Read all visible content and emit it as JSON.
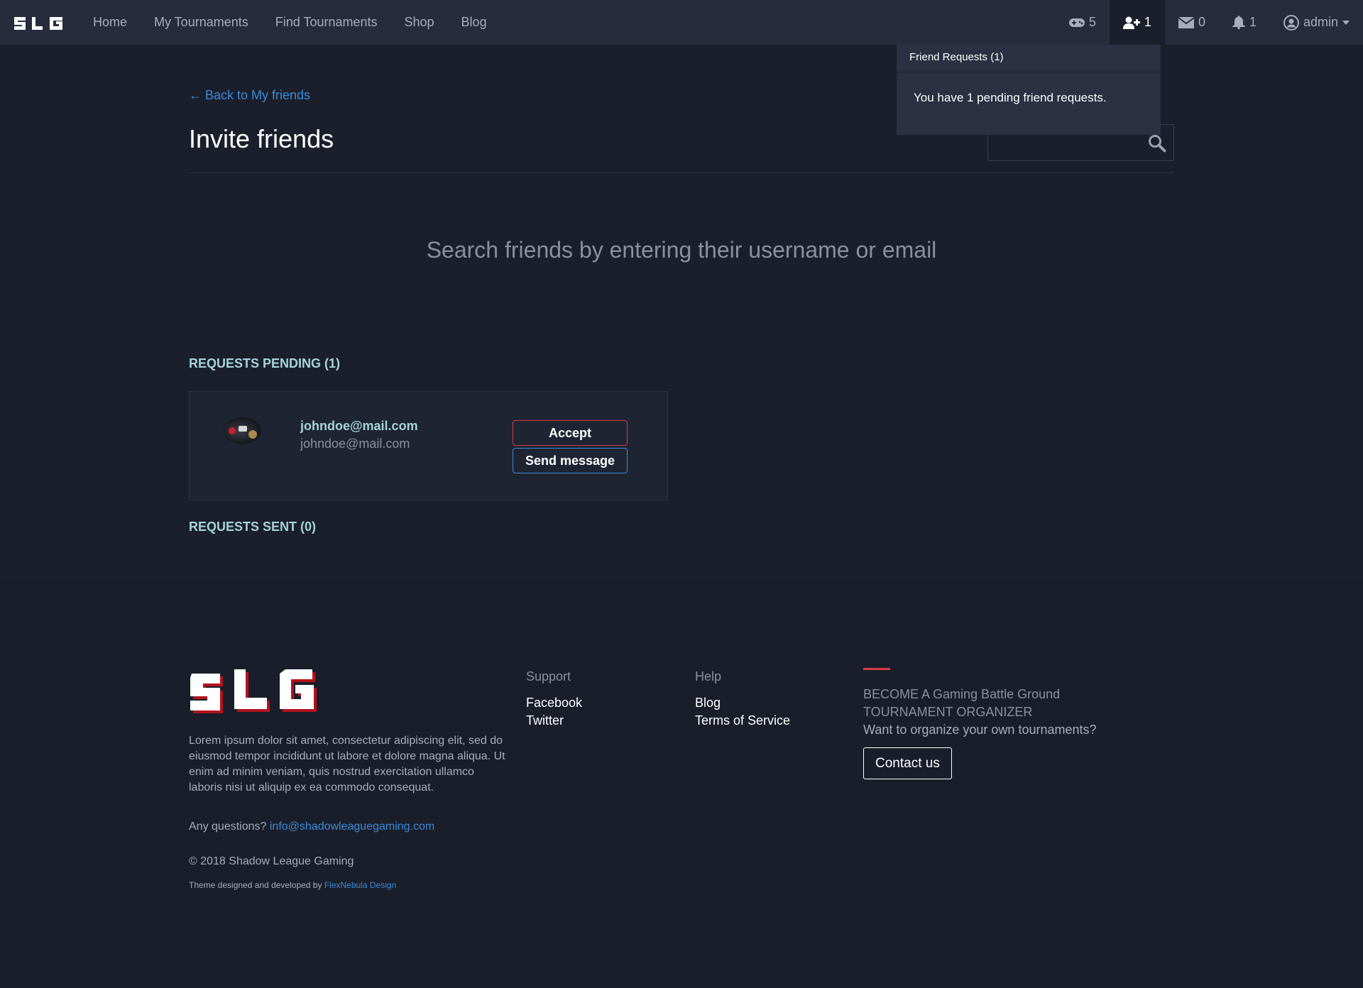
{
  "nav": {
    "brand": "SLG",
    "links": [
      "Home",
      "My Tournaments",
      "Find Tournaments",
      "Shop",
      "Blog"
    ],
    "games_count": "5",
    "friends_count": "1",
    "messages_count": "0",
    "notifications_count": "1",
    "user": "admin"
  },
  "dropdown": {
    "header": "Friend Requests (1)",
    "body": "You have 1 pending friend requests."
  },
  "main": {
    "back_link": "← Back to My friends",
    "title": "Invite friends",
    "search_value": "",
    "search_hint": "Search friends by entering their username or email",
    "pending_label": "REQUESTS PENDING (1)",
    "sent_label": "REQUESTS SENT (0)",
    "request": {
      "name": "johndoe@mail.com",
      "email": "johndoe@mail.com",
      "accept_label": "Accept",
      "message_label": "Send message"
    }
  },
  "footer": {
    "about": "Lorem ipsum dolor sit amet, consectetur adipiscing elit, sed do eiusmod tempor incididunt ut labore et dolore magna aliqua. Ut enim ad minim veniam, quis nostrud exercitation ullamco laboris nisi ut aliquip ex ea commodo consequat.",
    "questions_label": "Any questions?",
    "email": "info@shadowleaguegaming.com",
    "copyright": "© 2018 Shadow League Gaming",
    "credit_prefix": "Theme designed and developed by",
    "credit_link": "FlexNebula Design",
    "support": {
      "title": "Support",
      "links": [
        "Facebook",
        "Twitter"
      ]
    },
    "help": {
      "title": "Help",
      "links": [
        "Blog",
        "Terms of Service"
      ]
    },
    "cta": {
      "line1": "BECOME A Gaming Battle Ground",
      "line2": "TOURNAMENT ORGANIZER",
      "line3": "Want to organize your own tournaments?",
      "button": "Contact us"
    }
  },
  "colors": {
    "background": "#1b1f2b",
    "navbar": "#272c3c",
    "accent_blue": "#3b8bd8",
    "accent_red": "#d43b46",
    "label_teal": "#a4d4dc"
  }
}
